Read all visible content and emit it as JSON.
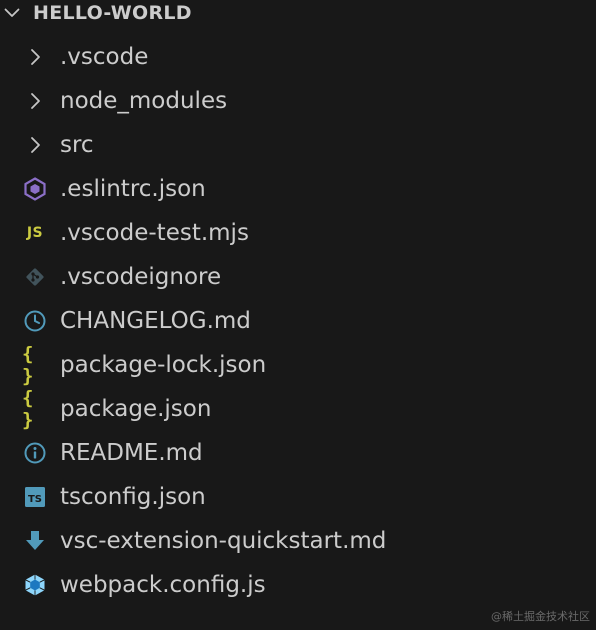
{
  "explorer": {
    "section_title": "HELLO-WORLD"
  },
  "colors": {
    "background": "#181818",
    "text": "#cccccc",
    "chevron": "#c5c5c5",
    "eslint": "#8b6fc7",
    "js": "#cbcb41",
    "git": "#41535b",
    "changelog": "#519aba",
    "json": "#cbcb41",
    "readme": "#519aba",
    "tsconfig": "#519aba",
    "download": "#519aba",
    "webpack": "#519aba"
  },
  "tree": {
    "items": [
      {
        "label": ".vscode",
        "kind": "folder",
        "icon": "chevron-right-icon"
      },
      {
        "label": "node_modules",
        "kind": "folder",
        "icon": "chevron-right-icon"
      },
      {
        "label": "src",
        "kind": "folder",
        "icon": "chevron-right-icon"
      },
      {
        "label": ".eslintrc.json",
        "kind": "file",
        "icon": "eslint-icon"
      },
      {
        "label": ".vscode-test.mjs",
        "kind": "file",
        "icon": "javascript-icon",
        "icon_text": "JS"
      },
      {
        "label": ".vscodeignore",
        "kind": "file",
        "icon": "git-icon"
      },
      {
        "label": "CHANGELOG.md",
        "kind": "file",
        "icon": "clock-icon"
      },
      {
        "label": "package-lock.json",
        "kind": "file",
        "icon": "json-icon",
        "icon_text": "{ }"
      },
      {
        "label": "package.json",
        "kind": "file",
        "icon": "json-icon",
        "icon_text": "{ }"
      },
      {
        "label": "README.md",
        "kind": "file",
        "icon": "info-icon"
      },
      {
        "label": "tsconfig.json",
        "kind": "file",
        "icon": "tsconfig-icon",
        "icon_text": "TS"
      },
      {
        "label": "vsc-extension-quickstart.md",
        "kind": "file",
        "icon": "download-icon"
      },
      {
        "label": "webpack.config.js",
        "kind": "file",
        "icon": "webpack-icon"
      }
    ]
  },
  "watermark": "@稀土掘金技术社区"
}
